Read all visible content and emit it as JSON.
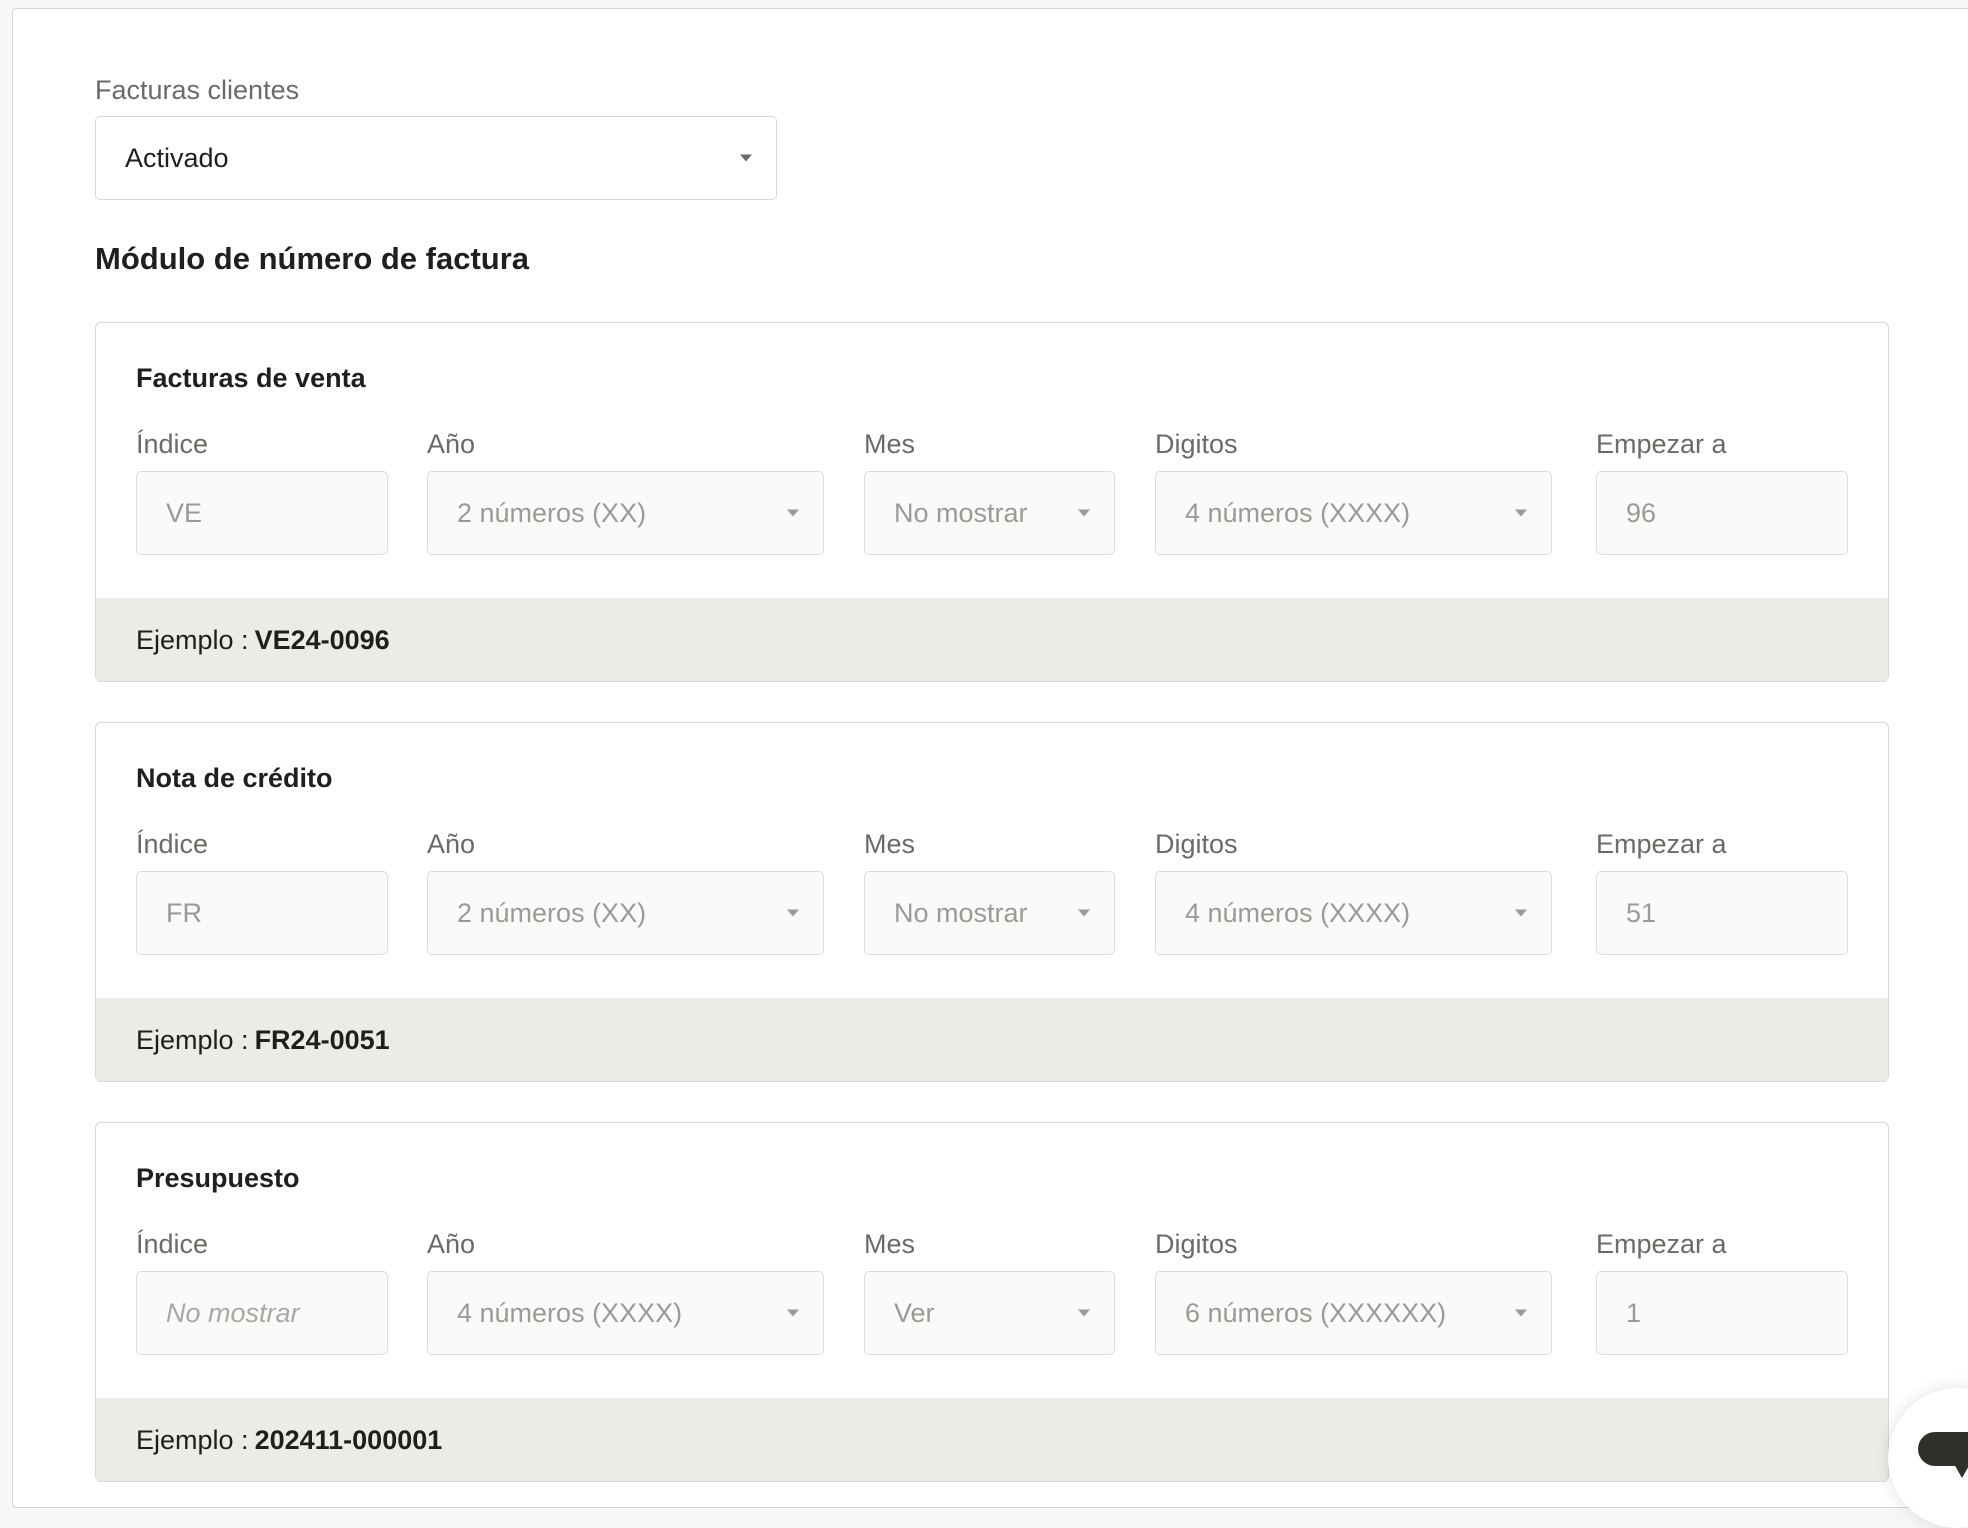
{
  "client_invoices": {
    "label": "Facturas clientes",
    "value": "Activado"
  },
  "section_title": "Módulo de número de factura",
  "example_label": "Ejemplo :",
  "cards": [
    {
      "title": "Facturas de venta",
      "fields": {
        "index": {
          "label": "Índice",
          "value": "VE"
        },
        "year": {
          "label": "Año",
          "value": "2 números (XX)"
        },
        "month": {
          "label": "Mes",
          "value": "No mostrar"
        },
        "digits": {
          "label": "Digitos",
          "value": "4 números (XXXX)"
        },
        "start": {
          "label": "Empezar a",
          "value": "96"
        }
      },
      "example": "VE24-0096"
    },
    {
      "title": "Nota de crédito",
      "fields": {
        "index": {
          "label": "Índice",
          "value": "FR"
        },
        "year": {
          "label": "Año",
          "value": "2 números (XX)"
        },
        "month": {
          "label": "Mes",
          "value": "No mostrar"
        },
        "digits": {
          "label": "Digitos",
          "value": "4 números (XXXX)"
        },
        "start": {
          "label": "Empezar a",
          "value": "51"
        }
      },
      "example": "FR24-0051"
    },
    {
      "title": "Presupuesto",
      "fields": {
        "index": {
          "label": "Índice",
          "value": "",
          "placeholder": "No mostrar"
        },
        "year": {
          "label": "Año",
          "value": "4 números (XXXX)"
        },
        "month": {
          "label": "Mes",
          "value": "Ver"
        },
        "digits": {
          "label": "Digitos",
          "value": "6 números (XXXXXX)"
        },
        "start": {
          "label": "Empezar a",
          "value": "1"
        }
      },
      "example": "202411-000001"
    }
  ],
  "icons": {
    "dropdown": "chevron-down-icon",
    "chat": "chat-icon"
  }
}
